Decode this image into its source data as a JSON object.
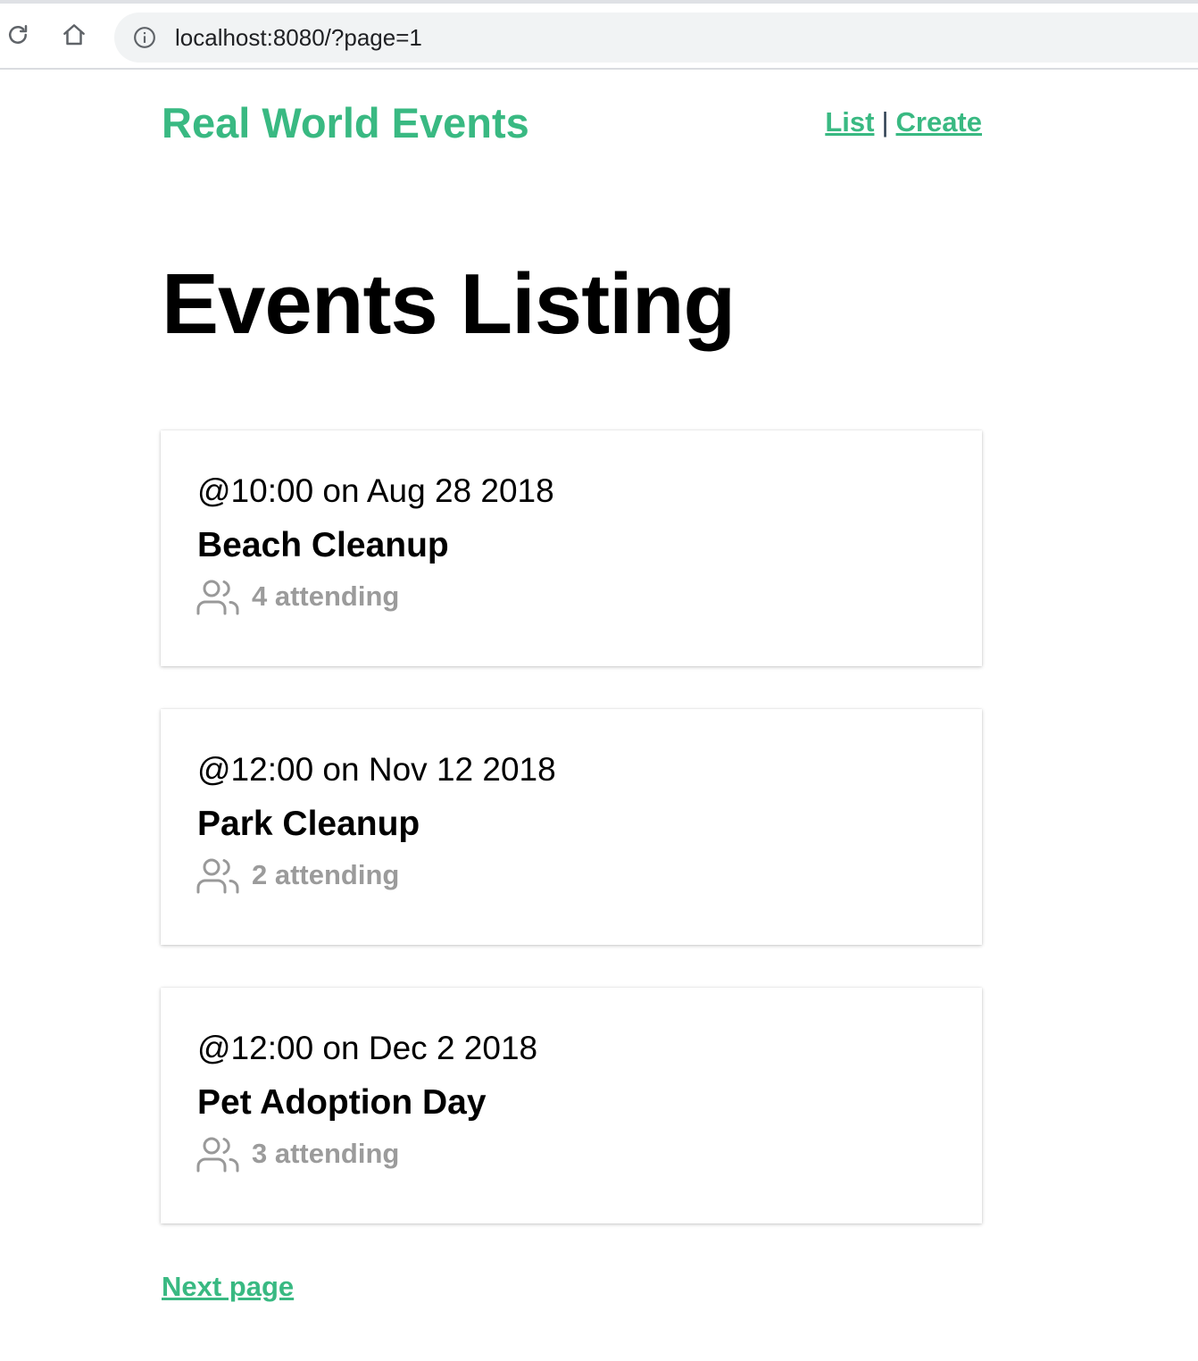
{
  "browser": {
    "url": "localhost:8080/?page=1"
  },
  "nav": {
    "brand": "Real World Events",
    "list_label": "List",
    "separator": "|",
    "create_label": "Create"
  },
  "page": {
    "title": "Events Listing"
  },
  "events": [
    {
      "when": "@10:00 on Aug 28 2018",
      "title": "Beach Cleanup",
      "attending": "4 attending"
    },
    {
      "when": "@12:00 on Nov 12 2018",
      "title": "Park Cleanup",
      "attending": "2 attending"
    },
    {
      "when": "@12:00 on Dec 2 2018",
      "title": "Pet Adoption Day",
      "attending": "3 attending"
    }
  ],
  "pagination": {
    "next_label": "Next page"
  },
  "colors": {
    "brand_green": "#39b982",
    "muted_gray": "#999999",
    "chrome_bar": "#f1f3f4"
  },
  "icons": {
    "reload": "reload-icon",
    "home": "home-icon",
    "info": "info-icon",
    "attendees": "users-icon"
  }
}
